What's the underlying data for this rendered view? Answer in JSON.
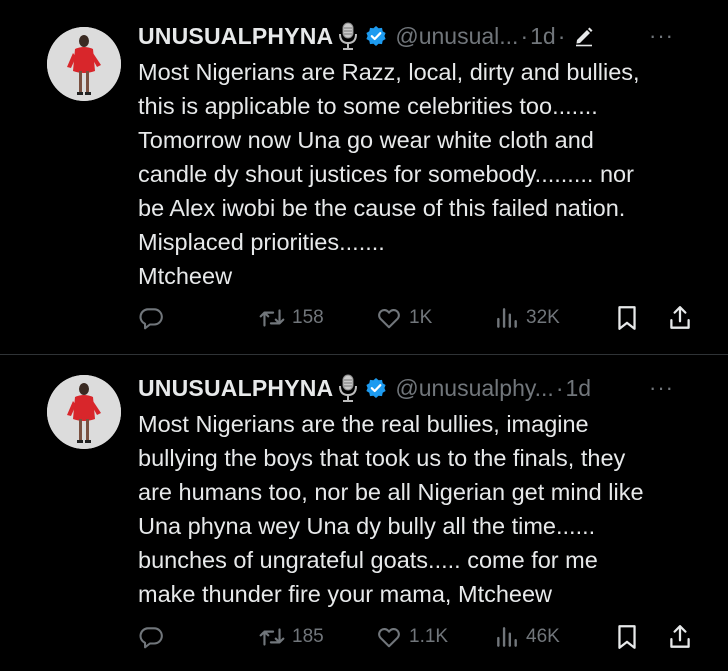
{
  "tweets": [
    {
      "display_name": "UNUSUALPHYNA",
      "handle": "@unusual...",
      "separator": "·",
      "time": "1d",
      "time_separator": "·",
      "more": "···",
      "lines": [
        "Most Nigerians are Razz, local, dirty and bullies,",
        "this is applicable to some celebrities too.......",
        "Tomorrow now Una go wear white cloth and",
        "candle dy shout justices for somebody......... nor",
        "be Alex iwobi be the cause of this failed nation.",
        "Misplaced priorities.......",
        "Mtcheew"
      ],
      "stats": {
        "retweets": "158",
        "likes": "1K",
        "views": "32K"
      }
    },
    {
      "display_name": "UNUSUALPHYNA",
      "handle": "@unusualphy...",
      "separator": "·",
      "time": "1d",
      "more": "···",
      "lines": [
        "Most Nigerians are the real bullies, imagine",
        "bullying the boys that took us to the finals, they",
        "are humans too, nor be all Nigerian get mind like",
        "Una phyna wey Una dy bully all the time......",
        "bunches of ungrateful goats..... come for me",
        "make thunder fire your mama, Mtcheew"
      ],
      "stats": {
        "retweets": "185",
        "likes": "1.1K",
        "views": "46K"
      }
    }
  ],
  "icons": {
    "mic": "microphone-emoji-icon",
    "verified": "verified-badge-icon",
    "edit": "edit-pencil-icon",
    "reply": "reply-icon",
    "retweet": "retweet-icon",
    "like": "heart-icon",
    "views": "views-icon",
    "bookmark": "bookmark-icon",
    "share": "share-icon"
  },
  "colors": {
    "background": "#000000",
    "text": "#e7e9ea",
    "secondary": "#71767b",
    "divider": "#2f3336",
    "verified": "#1d9bf0"
  }
}
